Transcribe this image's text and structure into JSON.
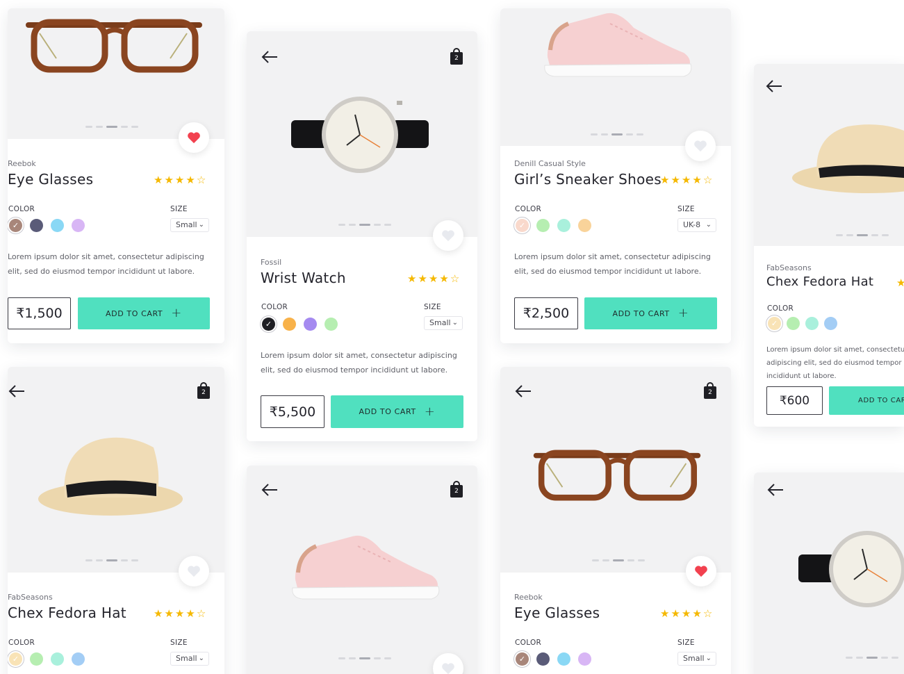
{
  "labels": {
    "color": "COLOR",
    "size": "SIZE",
    "add_to_cart": "ADD TO CART",
    "plus": "+",
    "cart_count": "2"
  },
  "products": {
    "glasses_top": {
      "brand": "Reebok",
      "title": "Eye Glasses",
      "size": "Small",
      "price": "₹1,500",
      "rating": 4
    },
    "watch": {
      "brand": "Fossil",
      "title": "Wrist Watch",
      "size": "Small",
      "price": "₹5,500",
      "rating": 4
    },
    "shoes": {
      "brand": "Denill Casual Style",
      "title": "Girl’s Sneaker Shoes",
      "size": "UK-8",
      "price": "₹2,500",
      "rating": 4
    },
    "hat_right": {
      "brand": "FabSeasons",
      "title": "Chex Fedora Hat",
      "price": "₹600",
      "cart_label": "ADD TO CART"
    },
    "hat_bottom": {
      "brand": "FabSeasons",
      "title": "Chex Fedora Hat",
      "size": "Small",
      "rating": 4
    },
    "glasses_bottom": {
      "brand": "Reebok",
      "title": "Eye Glasses",
      "size": "Small",
      "rating": 4
    }
  },
  "description": "Lorem ipsum dolor sit amet, consectetur adipiscing elit, sed do eiusmod tempor incididunt ut labore.",
  "colors": {
    "accent": "#50e0bf",
    "heart_active": "#f2414f",
    "heart_inactive": "#e8eaef",
    "star": "#f5b800"
  },
  "icons": {
    "back": "arrow-left-icon",
    "bag": "shopping-bag-icon",
    "heart": "heart-icon",
    "star": "star-icon"
  }
}
